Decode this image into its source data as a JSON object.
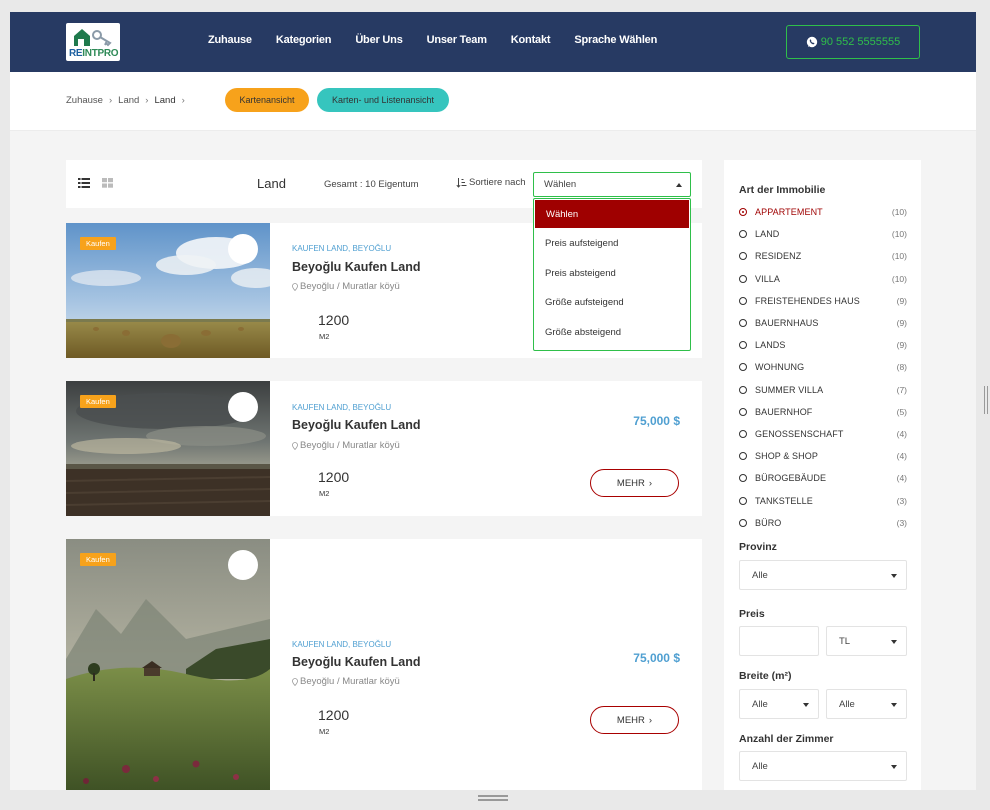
{
  "header": {
    "logo_text_re": "RE",
    "logo_text_in": "INTPRO",
    "nav": [
      "Zuhause",
      "Kategorien",
      "Über Uns",
      "Unser Team",
      "Kontakt",
      "Sprache Wählen"
    ],
    "phone": "90 552 5555555"
  },
  "breadcrumb": {
    "items": [
      "Zuhause",
      "Land",
      "Land"
    ],
    "sep": "›"
  },
  "view_buttons": {
    "map": "Kartenansicht",
    "map_list": "Karten- und Listenansicht"
  },
  "toolbar": {
    "title": "Land",
    "total": "Gesamt : 10 Eigentum",
    "sort_label": "Sortiere nach",
    "select_value": "Wählen"
  },
  "sort_options": [
    "Wählen",
    "Preis aufsteigend",
    "Preis absteigend",
    "Größe aufsteigend",
    "Größe absteigend"
  ],
  "listings": [
    {
      "badge": "Kaufen",
      "category": "KAUFEN LAND, BEYOĞLU",
      "title": "Beyoğlu Kaufen Land",
      "location": "Beyoğlu / Muratlar köyü",
      "area": "1200",
      "unit": "M2",
      "price": "",
      "more": "MEHR"
    },
    {
      "badge": "Kaufen",
      "category": "KAUFEN LAND, BEYOĞLU",
      "title": "Beyoğlu Kaufen Land",
      "location": "Beyoğlu / Muratlar köyü",
      "area": "1200",
      "unit": "M2",
      "price": "75,000 $",
      "more": "MEHR"
    },
    {
      "badge": "Kaufen",
      "category": "KAUFEN LAND, BEYOĞLU",
      "title": "Beyoğlu Kaufen Land",
      "location": "Beyoğlu / Muratlar köyü",
      "area": "1200",
      "unit": "M2",
      "price": "75,000 $",
      "more": "MEHR"
    }
  ],
  "sidebar": {
    "type_heading": "Art der Immobilie",
    "types": [
      {
        "label": "APPARTEMENT",
        "count": "(10)",
        "selected": true
      },
      {
        "label": "LAND",
        "count": "(10)"
      },
      {
        "label": "RESIDENZ",
        "count": "(10)"
      },
      {
        "label": "VILLA",
        "count": "(10)"
      },
      {
        "label": "FREISTEHENDES HAUS",
        "count": "(9)"
      },
      {
        "label": "BAUERNHAUS",
        "count": "(9)"
      },
      {
        "label": "LANDS",
        "count": "(9)"
      },
      {
        "label": "WOHNUNG",
        "count": "(8)"
      },
      {
        "label": "SUMMER VILLA",
        "count": "(7)"
      },
      {
        "label": "BAUERNHOF",
        "count": "(5)"
      },
      {
        "label": "GENOSSENSCHAFT",
        "count": "(4)"
      },
      {
        "label": "SHOP & SHOP",
        "count": "(4)"
      },
      {
        "label": "BÜROGEBÄUDE",
        "count": "(4)"
      },
      {
        "label": "TANKSTELLE",
        "count": "(3)"
      },
      {
        "label": "BÜRO",
        "count": "(3)"
      }
    ],
    "province_heading": "Provinz",
    "province_value": "Alle",
    "price_heading": "Preis",
    "price_value": "",
    "currency_value": "TL",
    "width_heading": "Breite (m²)",
    "width_min": "Alle",
    "width_max": "Alle",
    "rooms_heading": "Anzahl der Zimmer",
    "rooms_value": "Alle"
  },
  "colors": {
    "header_bg": "#273a63",
    "accent_red": "#9f0000",
    "whatsapp_green": "#2fbf4a",
    "badge_orange": "#f7a21b",
    "teal": "#36c5be",
    "price_blue": "#4f9fd1"
  }
}
